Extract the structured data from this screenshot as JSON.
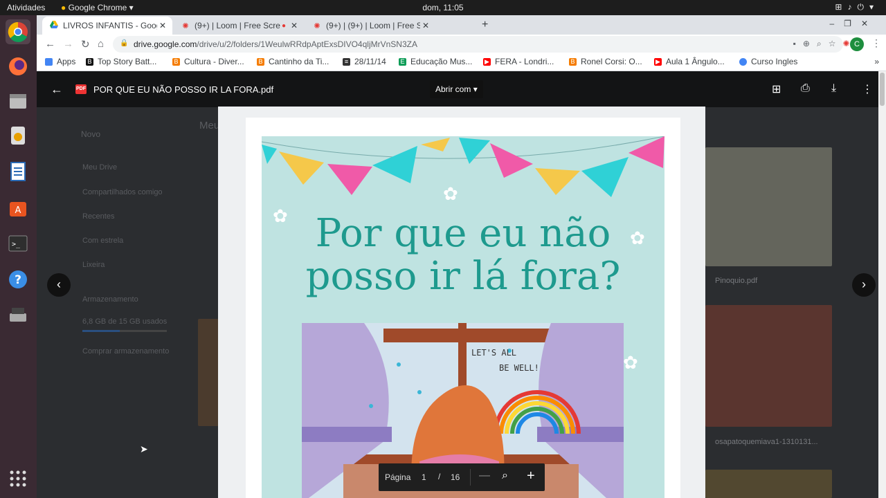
{
  "system": {
    "activities": "Atividades",
    "app_name": "Google Chrome",
    "clock": "dom, 11:05"
  },
  "chrome": {
    "tabs": [
      {
        "title": "LIVROS INFANTIS - Google",
        "favicon": "drive-icon"
      },
      {
        "title": "(9+) | Loom | Free Scre",
        "favicon": "loom-icon"
      },
      {
        "title": "(9+) | (9+) | Loom | Free Sc",
        "favicon": "loom-icon"
      }
    ],
    "url_domain": "drive.google.com",
    "url_path": "/drive/u/2/folders/1WeulwRRdpAptExsDIVO4qljMrVnSN3ZA",
    "avatar_letter": "C",
    "bookmarks": [
      {
        "label": "Apps",
        "color": "#4285f4"
      },
      {
        "label": "Top Story Batt...",
        "color": "#111111"
      },
      {
        "label": "Cultura - Diver...",
        "color": "#f57c00"
      },
      {
        "label": "Cantinho da Ti...",
        "color": "#f57c00"
      },
      {
        "label": "28/11/14",
        "color": "#333333"
      },
      {
        "label": "Educação Mus...",
        "color": "#0f9d58"
      },
      {
        "label": "FERA - Londri...",
        "color": "#ff0000"
      },
      {
        "label": "Ronel Corsi: O...",
        "color": "#f57c00"
      },
      {
        "label": "Aula 1 Ângulo...",
        "color": "#ff0000"
      },
      {
        "label": "Curso Ingles",
        "color": "#4285f4"
      }
    ],
    "bookmarks_more": "»"
  },
  "drive_background": {
    "new_button": "Novo",
    "breadcrumb": "Meu",
    "sidebar": [
      "Meu Drive",
      "Compartilhados comigo",
      "Recentes",
      "Com estrela",
      "Lixeira",
      "Armazenamento"
    ],
    "storage_used": "6,8 GB de 15 GB usados",
    "buy_storage": "Comprar armazenamento",
    "files": [
      "Pinoquio.pdf",
      "osapatoquemiava1-1310131..."
    ]
  },
  "viewer": {
    "file_title": "POR QUE EU NÃO POSSO IR LA FORA.pdf",
    "open_with": "Abrir com",
    "book_title_line1": "Por que eu não",
    "book_title_line2": "posso ir lá fora?",
    "illustration_text_1": "LET'S ALL",
    "illustration_text_2": "BE WELL!",
    "page_label": "Página",
    "current_page": "1",
    "page_separator": "/",
    "total_pages": "16"
  }
}
